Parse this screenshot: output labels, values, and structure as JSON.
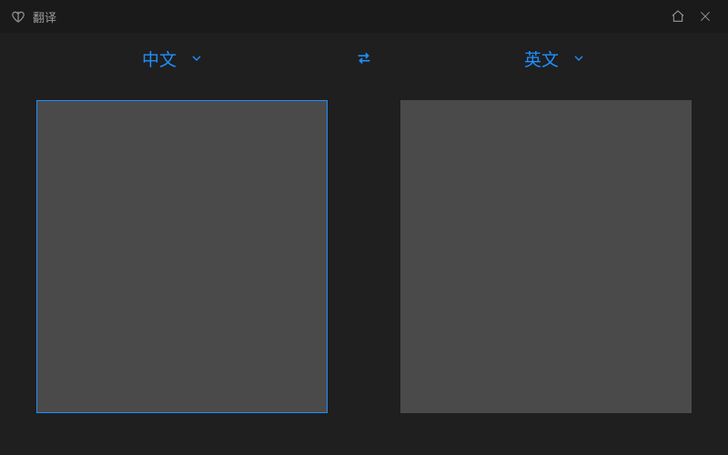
{
  "titlebar": {
    "title": "翻译"
  },
  "languages": {
    "source": "中文",
    "target": "英文"
  },
  "panels": {
    "source_value": "",
    "target_value": ""
  }
}
